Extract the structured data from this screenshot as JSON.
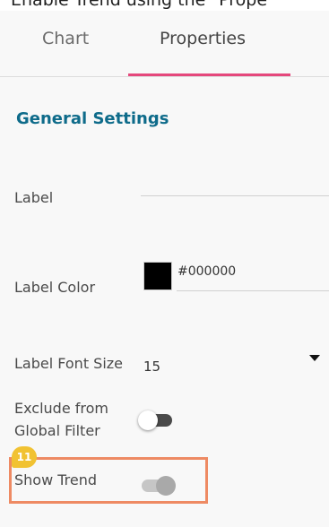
{
  "caption": "Enable Trend using the \"Prope",
  "tabs": [
    {
      "label": "Chart",
      "active": false
    },
    {
      "label": "Properties",
      "active": true
    }
  ],
  "section_title": "General Settings",
  "fields": {
    "label": {
      "label": "Label",
      "value": ""
    },
    "label_color": {
      "label": "Label Color",
      "value": "#000000"
    },
    "label_font_size": {
      "label": "Label Font Size",
      "value": "15"
    },
    "exclude_global_filter": {
      "label_line1": "Exclude from",
      "label_line2": "Global Filter",
      "on": false
    },
    "show_trend": {
      "label": "Show Trend",
      "on": false
    }
  },
  "step_badge": "11",
  "colors": {
    "active_tab_underline": "#e5487c",
    "section_title": "#0e6b8a",
    "highlight_border": "#ee8a63",
    "step_badge": "#f1c232"
  }
}
